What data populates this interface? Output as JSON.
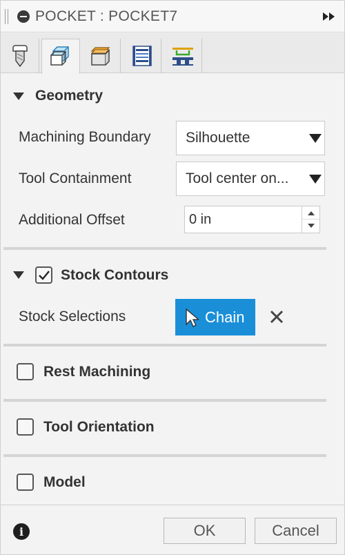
{
  "window": {
    "title": "POCKET : POCKET7"
  },
  "tabs": [
    {
      "name": "tool",
      "icon": "tool-icon"
    },
    {
      "name": "geometry",
      "icon": "geometry-icon",
      "active": true
    },
    {
      "name": "heights",
      "icon": "heights-icon"
    },
    {
      "name": "passes",
      "icon": "passes-icon"
    },
    {
      "name": "linking",
      "icon": "linking-icon"
    }
  ],
  "geometry": {
    "header": "Geometry",
    "machining_boundary": {
      "label": "Machining Boundary",
      "value": "Silhouette"
    },
    "tool_containment": {
      "label": "Tool Containment",
      "value": "Tool center on..."
    },
    "additional_offset": {
      "label": "Additional Offset",
      "value": "0 in"
    }
  },
  "stock_contours": {
    "header": "Stock Contours",
    "checked": true,
    "stock_selections_label": "Stock Selections",
    "chain_label": "Chain",
    "accent": "#1a8fd8"
  },
  "rest_machining": {
    "label": "Rest Machining",
    "checked": false
  },
  "tool_orientation": {
    "label": "Tool Orientation",
    "checked": false
  },
  "model": {
    "label": "Model",
    "checked": false
  },
  "footer": {
    "ok_label": "OK",
    "cancel_label": "Cancel"
  }
}
